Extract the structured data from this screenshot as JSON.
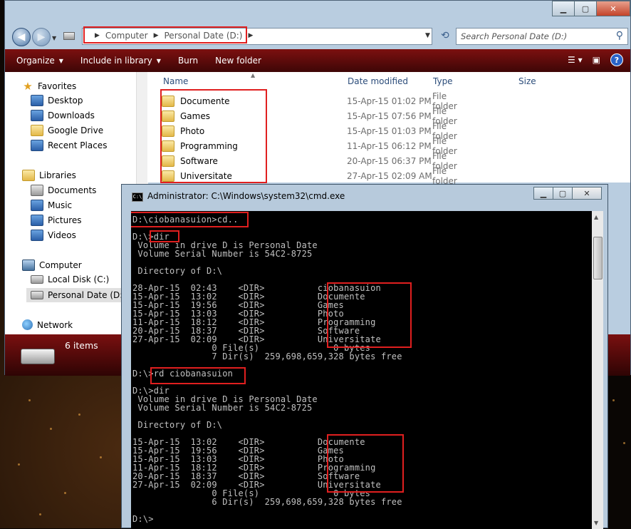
{
  "explorer": {
    "address": {
      "segments": [
        "Computer",
        "Personal Date (D:)"
      ]
    },
    "search_placeholder": "Search Personal Date (D:)",
    "toolbar": [
      "Organize",
      "Include in library",
      "Burn",
      "New folder"
    ],
    "nav": {
      "favorites": "Favorites",
      "favorites_items": [
        "Desktop",
        "Downloads",
        "Google Drive",
        "Recent Places"
      ],
      "libraries": "Libraries",
      "libraries_items": [
        "Documents",
        "Music",
        "Pictures",
        "Videos"
      ],
      "computer": "Computer",
      "computer_items": [
        "Local Disk (C:)",
        "Personal Date (D:)"
      ],
      "network": "Network"
    },
    "columns": {
      "name": "Name",
      "date": "Date modified",
      "type": "Type",
      "size": "Size"
    },
    "files": [
      {
        "name": "Documente",
        "date": "15-Apr-15 01:02 PM",
        "type": "File folder"
      },
      {
        "name": "Games",
        "date": "15-Apr-15 07:56 PM",
        "type": "File folder"
      },
      {
        "name": "Photo",
        "date": "15-Apr-15 01:03 PM",
        "type": "File folder"
      },
      {
        "name": "Programming",
        "date": "11-Apr-15 06:12 PM",
        "type": "File folder"
      },
      {
        "name": "Software",
        "date": "20-Apr-15 06:37 PM",
        "type": "File folder"
      },
      {
        "name": "Universitate",
        "date": "27-Apr-15 02:09 AM",
        "type": "File folder"
      }
    ],
    "status": "6 items"
  },
  "cmd": {
    "title": "Administrator: C:\\Windows\\system32\\cmd.exe",
    "lines": [
      "D:\\ciobanasuion>cd..",
      "",
      "D:\\>dir",
      " Volume in drive D is Personal Date",
      " Volume Serial Number is 54C2-8725",
      "",
      " Directory of D:\\",
      "",
      "28-Apr-15  02:43    <DIR>          ciobanasuion",
      "15-Apr-15  13:02    <DIR>          Documente",
      "15-Apr-15  19:56    <DIR>          Games",
      "15-Apr-15  13:03    <DIR>          Photo",
      "11-Apr-15  18:12    <DIR>          Programming",
      "20-Apr-15  18:37    <DIR>          Software",
      "27-Apr-15  02:09    <DIR>          Universitate",
      "               0 File(s)              0 bytes",
      "               7 Dir(s)  259,698,659,328 bytes free",
      "",
      "D:\\>rd ciobanasuion",
      "",
      "D:\\>dir",
      " Volume in drive D is Personal Date",
      " Volume Serial Number is 54C2-8725",
      "",
      " Directory of D:\\",
      "",
      "15-Apr-15  13:02    <DIR>          Documente",
      "15-Apr-15  19:56    <DIR>          Games",
      "15-Apr-15  13:03    <DIR>          Photo",
      "11-Apr-15  18:12    <DIR>          Programming",
      "20-Apr-15  18:37    <DIR>          Software",
      "27-Apr-15  02:09    <DIR>          Universitate",
      "               0 File(s)              0 bytes",
      "               6 Dir(s)  259,698,659,328 bytes free",
      "",
      "D:\\>"
    ]
  }
}
